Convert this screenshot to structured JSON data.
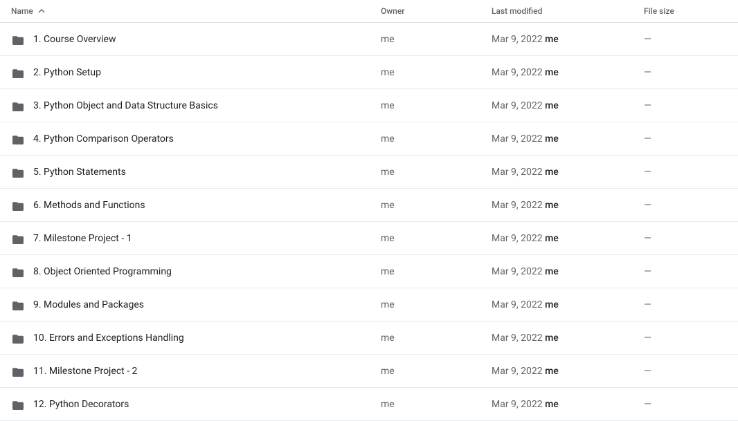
{
  "header": {
    "name_label": "Name",
    "owner_label": "Owner",
    "modified_label": "Last modified",
    "size_label": "File size"
  },
  "rows": [
    {
      "id": 1,
      "name": "1. Course Overview",
      "owner": "me",
      "modified": "Mar 9, 2022",
      "modified_by": "me",
      "size": "—"
    },
    {
      "id": 2,
      "name": "2. Python Setup",
      "owner": "me",
      "modified": "Mar 9, 2022",
      "modified_by": "me",
      "size": "—"
    },
    {
      "id": 3,
      "name": "3. Python Object and Data Structure Basics",
      "owner": "me",
      "modified": "Mar 9, 2022",
      "modified_by": "me",
      "size": "—"
    },
    {
      "id": 4,
      "name": "4. Python Comparison Operators",
      "owner": "me",
      "modified": "Mar 9, 2022",
      "modified_by": "me",
      "size": "—"
    },
    {
      "id": 5,
      "name": "5. Python Statements",
      "owner": "me",
      "modified": "Mar 9, 2022",
      "modified_by": "me",
      "size": "—"
    },
    {
      "id": 6,
      "name": "6. Methods and Functions",
      "owner": "me",
      "modified": "Mar 9, 2022",
      "modified_by": "me",
      "size": "—"
    },
    {
      "id": 7,
      "name": "7. Milestone Project - 1",
      "owner": "me",
      "modified": "Mar 9, 2022",
      "modified_by": "me",
      "size": "—"
    },
    {
      "id": 8,
      "name": "8. Object Oriented Programming",
      "owner": "me",
      "modified": "Mar 9, 2022",
      "modified_by": "me",
      "size": "—"
    },
    {
      "id": 9,
      "name": "9. Modules and Packages",
      "owner": "me",
      "modified": "Mar 9, 2022",
      "modified_by": "me",
      "size": "—"
    },
    {
      "id": 10,
      "name": "10. Errors and Exceptions Handling",
      "owner": "me",
      "modified": "Mar 9, 2022",
      "modified_by": "me",
      "size": "—"
    },
    {
      "id": 11,
      "name": "11. Milestone Project - 2",
      "owner": "me",
      "modified": "Mar 9, 2022",
      "modified_by": "me",
      "size": "—"
    },
    {
      "id": 12,
      "name": "12. Python Decorators",
      "owner": "me",
      "modified": "Mar 9, 2022",
      "modified_by": "me",
      "size": "—"
    }
  ]
}
